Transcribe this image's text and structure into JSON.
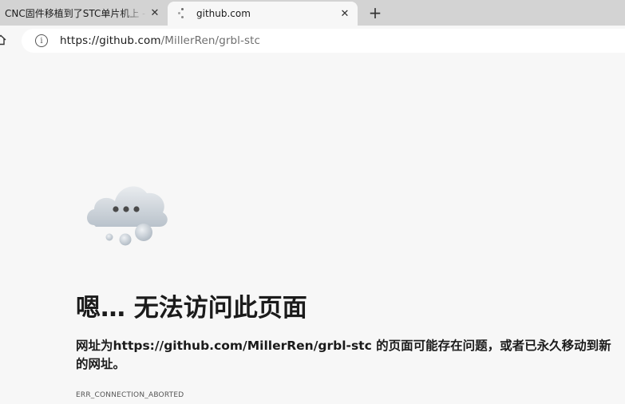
{
  "tabs": [
    {
      "title": "CNC固件移植到了STC单片机上 -",
      "close": "✕"
    },
    {
      "title": "github.com",
      "close": "✕"
    }
  ],
  "new_tab": "+",
  "address": {
    "url_host": "https://github.com",
    "url_rest": "/MillerRen/grbl-stc"
  },
  "error": {
    "title": "嗯… 无法访问此页面",
    "message": "网址为https://github.com/MillerRen/grbl-stc 的页面可能存在问题，或者已永久移动到新的网址。",
    "code": "ERR_CONNECTION_ABORTED"
  }
}
